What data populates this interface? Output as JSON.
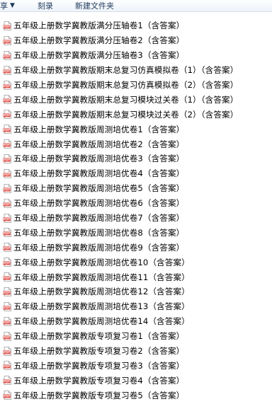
{
  "toolbar": {
    "share_label": "享",
    "burn_label": "刻录",
    "new_folder_label": "新建文件夹"
  },
  "icons": {
    "file_icon": "pdf-icon",
    "pdf_badge_text": "PDF",
    "pdf_badge_color": "#d9342b"
  },
  "files": [
    "五年级上册数学冀教版满分压轴卷1（含答案）",
    "五年级上册数学冀教版满分压轴卷2（含答案）",
    "五年级上册数学冀教版满分压轴卷3（含答案）",
    "五年级上册数学冀教版期末总复习仿真模拟卷（1）（含答案）",
    "五年级上册数学冀教版期末总复习仿真模拟卷（2）（含答案）",
    "五年级上册数学冀教版期末总复习模块过关卷（1）（含答案）",
    "五年级上册数学冀教版期末总复习模块过关卷（2）（含答案）",
    "五年级上册数学冀教版周测培优卷1（含答案）",
    "五年级上册数学冀教版周测培优卷2（含答案）",
    "五年级上册数学冀教版周测培优卷3（含答案）",
    "五年级上册数学冀教版周测培优卷4（含答案）",
    "五年级上册数学冀教版周测培优卷5（含答案）",
    "五年级上册数学冀教版周测培优卷6（含答案）",
    "五年级上册数学冀教版周测培优卷7（含答案）",
    "五年级上册数学冀教版周测培优卷8（含答案）",
    "五年级上册数学冀教版周测培优卷9（含答案）",
    "五年级上册数学冀教版周测培优卷10（含答案）",
    "五年级上册数学冀教版周测培优卷11（含答案）",
    "五年级上册数学冀教版周测培优卷12（含答案）",
    "五年级上册数学冀教版周测培优卷13（含答案）",
    "五年级上册数学冀教版周测培优卷14（含答案）",
    "五年级上册数学冀教版专项复习卷1（含答案）",
    "五年级上册数学冀教版专项复习卷2（含答案）",
    "五年级上册数学冀教版专项复习卷3（含答案）",
    "五年级上册数学冀教版专项复习卷4（含答案）",
    "五年级上册数学冀教版专项复习卷5（含答案）"
  ]
}
